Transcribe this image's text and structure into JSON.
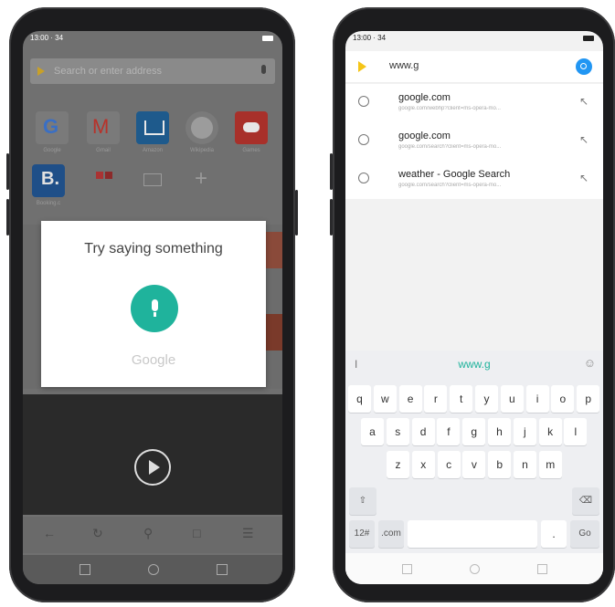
{
  "left_phone": {
    "status_time": "13:00 · 34",
    "search_placeholder": "Search or enter address",
    "tiles": [
      {
        "label": "Google",
        "icon": "google-icon",
        "color": "#4285f4"
      },
      {
        "label": "Gmail",
        "icon": "gmail-icon",
        "color": "#ea4335"
      },
      {
        "label": "Amazon",
        "icon": "amazon-icon",
        "color": "#1e6aa8"
      },
      {
        "label": "Wikipedia",
        "icon": "wikipedia-icon",
        "color": "#cfcfcf"
      },
      {
        "label": "Games",
        "icon": "games-icon",
        "color": "#d9342b"
      },
      {
        "label": "Booking.c",
        "icon": "booking-icon",
        "color": "#1f5fa8"
      }
    ],
    "voice_dialog": {
      "title": "Try saying something",
      "brand": "Google"
    },
    "toolbar_icons": [
      "back-icon",
      "reload-icon",
      "search-icon",
      "tabs-icon",
      "menu-icon"
    ]
  },
  "right_phone": {
    "status_time": "13:00 · 34",
    "search_value": "www.g",
    "suggestions": [
      {
        "title": "google.com",
        "url": "google.com/webhp?client=ms-opera-mo..."
      },
      {
        "title": "google.com",
        "url": "google.com/search?client=ms-opera-mo..."
      },
      {
        "title": "weather - Google Search",
        "url": "google.com/search?client=ms-opera-mo..."
      }
    ],
    "keyboard": {
      "suggestion": "www.g",
      "row1": [
        "q",
        "w",
        "e",
        "r",
        "t",
        "y",
        "u",
        "i",
        "o",
        "p"
      ],
      "row2": [
        "a",
        "s",
        "d",
        "f",
        "g",
        "h",
        "j",
        "k",
        "l"
      ],
      "row3": [
        "z",
        "x",
        "c",
        "v",
        "b",
        "n",
        "m"
      ],
      "sym_key": "12#",
      "com_key": ".com",
      "dot_key": ".",
      "go_key": "Go"
    }
  }
}
